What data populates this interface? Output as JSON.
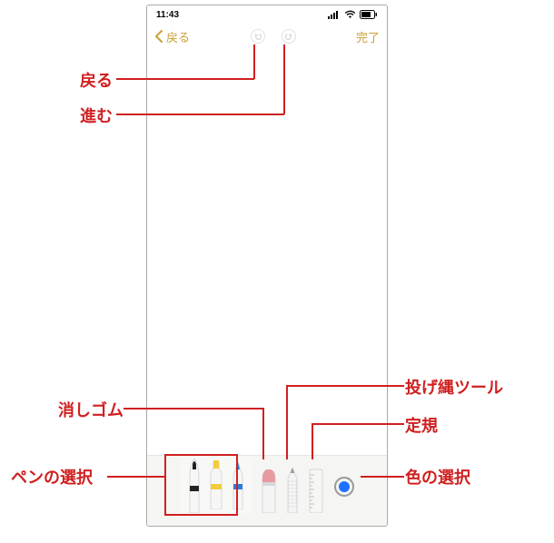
{
  "statusbar": {
    "time": "11:43"
  },
  "nav": {
    "back_label": "戻る",
    "done_label": "完了"
  },
  "toolbar": {
    "tools": {
      "pen_black": "black-pen",
      "pen_yellow": "yellow-marker",
      "pen_blue": "blue-pencil",
      "eraser": "eraser",
      "lasso": "lasso",
      "ruler": "ruler"
    },
    "color": "#2070ff"
  },
  "annotations": {
    "undo": "戻る",
    "redo": "進む",
    "pen_select": "ペンの選択",
    "eraser": "消しゴム",
    "lasso": "投げ縄ツール",
    "ruler": "定規",
    "color_select": "色の選択"
  }
}
